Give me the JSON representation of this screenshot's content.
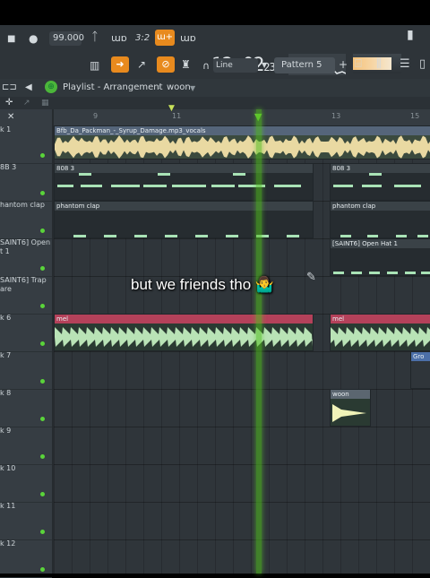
{
  "toolbar": {
    "tempo": "99.000",
    "pattern_mode": "3:2",
    "clock_main": "12:02",
    "clock_sub": "23",
    "snap": "Line",
    "pattern": "Pattern 5",
    "cpu_fill": 0.8
  },
  "playlist": {
    "title": "Playlist - Arrangement",
    "sep": "›",
    "arrangement": "woon"
  },
  "ruler": {
    "ticks": [
      "9",
      "11",
      "13",
      "15"
    ]
  },
  "tracks": [
    {
      "name": "k 1",
      "dot": true
    },
    {
      "name": "8B 3",
      "dot": true
    },
    {
      "name": "hantom clap",
      "dot": true
    },
    {
      "name": "SAINT6] Open\nt 1",
      "dot": true
    },
    {
      "name": "SAINT6] Trap\nare",
      "dot": true
    },
    {
      "name": "k 6",
      "dot": true
    },
    {
      "name": "k 7",
      "dot": true
    },
    {
      "name": "k 8",
      "dot": true
    },
    {
      "name": "k 9",
      "dot": true
    },
    {
      "name": "k 10",
      "dot": true
    },
    {
      "name": "k 11",
      "dot": true
    },
    {
      "name": "k 12",
      "dot": true
    }
  ],
  "clips": [
    {
      "label": "Bfb_Da_Packman_-_Syrup_Damage.mp3_vocals"
    },
    {
      "label": "808 3"
    },
    {
      "label": "808 3"
    },
    {
      "label": "phantom clap"
    },
    {
      "label": "phantom clap"
    },
    {
      "label": "[SAINT6] Open Hat 1"
    },
    {
      "label": "mel"
    },
    {
      "label": "mel"
    },
    {
      "label": "Gro"
    },
    {
      "label": "woon"
    }
  ],
  "caption": "but we friends tho 🤷‍♂️"
}
